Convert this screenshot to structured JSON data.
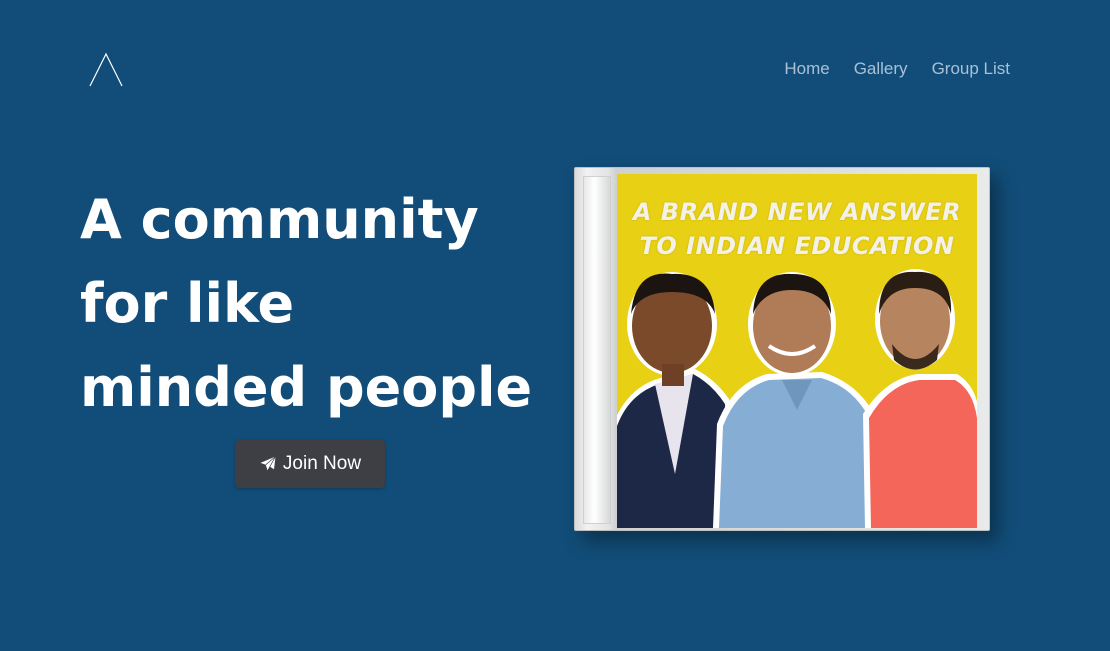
{
  "logo": {
    "icon": "triangle-logo-icon"
  },
  "nav": {
    "items": [
      {
        "label": "Home"
      },
      {
        "label": "Gallery"
      },
      {
        "label": "Group List"
      }
    ]
  },
  "hero": {
    "title_lines": [
      "A community",
      "for like",
      "minded people"
    ],
    "join_label": "Join Now",
    "join_icon": "paper-plane-icon"
  },
  "album": {
    "cover_line_1": "A BRAND NEW ANSWER",
    "cover_line_2": "TO INDIAN EDUCATION",
    "cover_color": "#e8d014"
  },
  "colors": {
    "background": "#114d78",
    "nav_text": "#a8c1d8",
    "button_bg": "#3d3f44"
  }
}
